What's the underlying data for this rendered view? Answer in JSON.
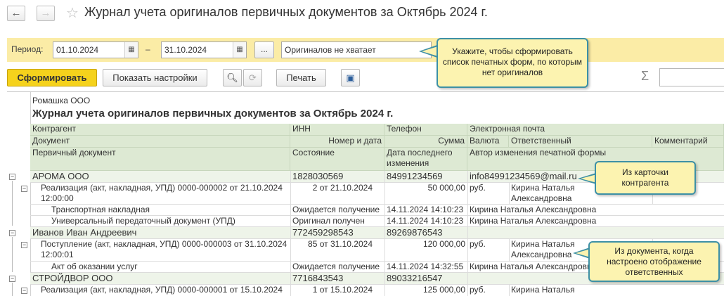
{
  "window": {
    "back_icon": "back-arrow-icon",
    "forward_icon": "forward-arrow-icon",
    "favorite_icon": "star-icon",
    "title": "Журнал учета оригиналов первичных документов за Октябрь 2024 г."
  },
  "filter": {
    "period_label": "Период:",
    "date_from": "01.10.2024",
    "dash": "–",
    "date_to": "31.10.2024",
    "ellipsis": "...",
    "mode_value": "Оригиналов не хватает",
    "calendar_icon": "calendar-icon"
  },
  "toolbar": {
    "generate": "Сформировать",
    "show_settings": "Показать настройки",
    "print": "Печать",
    "sigma": "Σ"
  },
  "report": {
    "org": "Ромашка ООО",
    "title": "Журнал учета оригиналов первичных документов за Октябрь 2024 г.",
    "headers": {
      "r1": [
        "Контрагент",
        "ИНН",
        "Телефон",
        "Электронная почта"
      ],
      "r2": [
        "Документ",
        "Номер и дата",
        "Сумма",
        "Валюта",
        "Ответственный",
        "Комментарий"
      ],
      "r3": [
        "Первичный документ",
        "Состояние",
        "Дата последнего изменения",
        "Автор изменения печатной формы"
      ]
    },
    "rows": [
      {
        "kind": "group",
        "c1": "АРОМА ООО",
        "c2": "1828030569",
        "c3": "84991234569",
        "c4": "info84991234569@mail.ru"
      },
      {
        "kind": "doc",
        "c1a": "Реализация (акт, накладная, УПД) 0000-000002 от 21.10.2024",
        "c1b": "12:00:00",
        "c2": "2 от 21.10.2024",
        "c3": "50 000,00",
        "c4": "руб.",
        "c5a": "Кирина Наталья",
        "c5b": "Александровна"
      },
      {
        "kind": "item",
        "c1": "Транспортная накладная",
        "c2": "Ожидается получение",
        "c3": "14.11.2024 14:10:23",
        "c4": "Кирина Наталья Александровна"
      },
      {
        "kind": "item",
        "c1": "Универсальный передаточный документ (УПД)",
        "c2": "Оригинал получен",
        "c3": "14.11.2024 14:10:23",
        "c4": "Кирина Наталья Александровна"
      },
      {
        "kind": "group",
        "c1": "Иванов Иван Андреевич",
        "c2": "772459298543",
        "c3": "89269876543",
        "c4": ""
      },
      {
        "kind": "doc",
        "c1a": "Поступление (акт, накладная, УПД) 0000-000003 от 31.10.2024",
        "c1b": "12:00:01",
        "c2": "85 от 31.10.2024",
        "c3": "120 000,00",
        "c4": "руб.",
        "c5a": "Кирина Наталья",
        "c5b": "Александровна"
      },
      {
        "kind": "item",
        "c1": "Акт об оказании услуг",
        "c2": "Ожидается получение",
        "c3": "14.11.2024 14:32:55",
        "c4": "Кирина Наталья Александровна"
      },
      {
        "kind": "group",
        "c1": "СТРОЙДВОР ООО",
        "c2": "7716843543",
        "c3": "89033216547",
        "c4": ""
      },
      {
        "kind": "doc",
        "c1a": "Реализация (акт, накладная, УПД) 0000-000001 от 15.10.2024",
        "c1b": "",
        "c2": "1 от 15.10.2024",
        "c3": "125 000,00",
        "c4": "руб.",
        "c5a": "Кирина Наталья",
        "c5b": ""
      }
    ]
  },
  "callouts": {
    "c1": "Укажите, чтобы сформировать список печатных форм, по которым нет оригиналов",
    "c2": "Из карточки контрагента",
    "c3": "Из документа, когда настроено отображение ответственных"
  }
}
